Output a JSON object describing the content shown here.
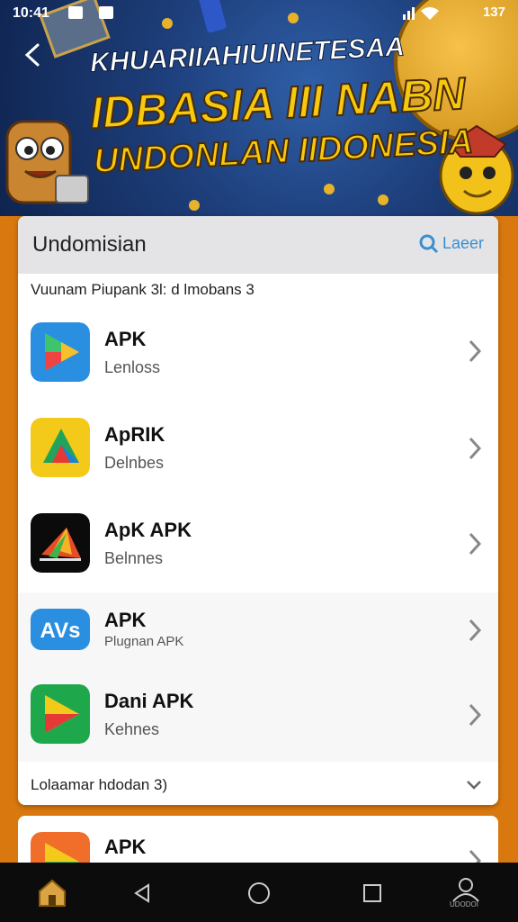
{
  "status_bar": {
    "time": "10:41",
    "right_text": "137"
  },
  "banner": {
    "line1": "KHUARIIAHIUINETESAA",
    "line2": "IDBASIA III NABN",
    "line3": "UNDONLAN IIDONESIA"
  },
  "card": {
    "title": "Undomisian",
    "search_label": "Laeer",
    "subtitle": "Vuunam Piupank 3l: d lmobans 3",
    "apps": [
      {
        "name": "APK",
        "sub": "Lenloss",
        "icon": "play-blue-icon"
      },
      {
        "name": "ApRIK",
        "sub": "Delnbes",
        "icon": "play-yellow-icon"
      },
      {
        "name": "ApK APK",
        "sub": "Belnnes",
        "icon": "tent-dark-icon"
      },
      {
        "name": "APK",
        "sub": "Plugnan APK",
        "icon": "avs-icon"
      },
      {
        "name": "Dani APK",
        "sub": "Kehnes",
        "icon": "play-green-icon"
      }
    ],
    "footer_label": "Lolaamar hdodan 3)"
  },
  "card2": {
    "app_name": "APK"
  },
  "nav": {
    "home_icon": "home-icon",
    "back_icon": "back-triangle-icon",
    "circle_icon": "home-circle-icon",
    "square_icon": "recents-square-icon",
    "profile_icon": "profile-icon",
    "profile_caption": "UDODOI"
  },
  "colors": {
    "accent": "#d9780f",
    "link": "#3a8fd0"
  }
}
